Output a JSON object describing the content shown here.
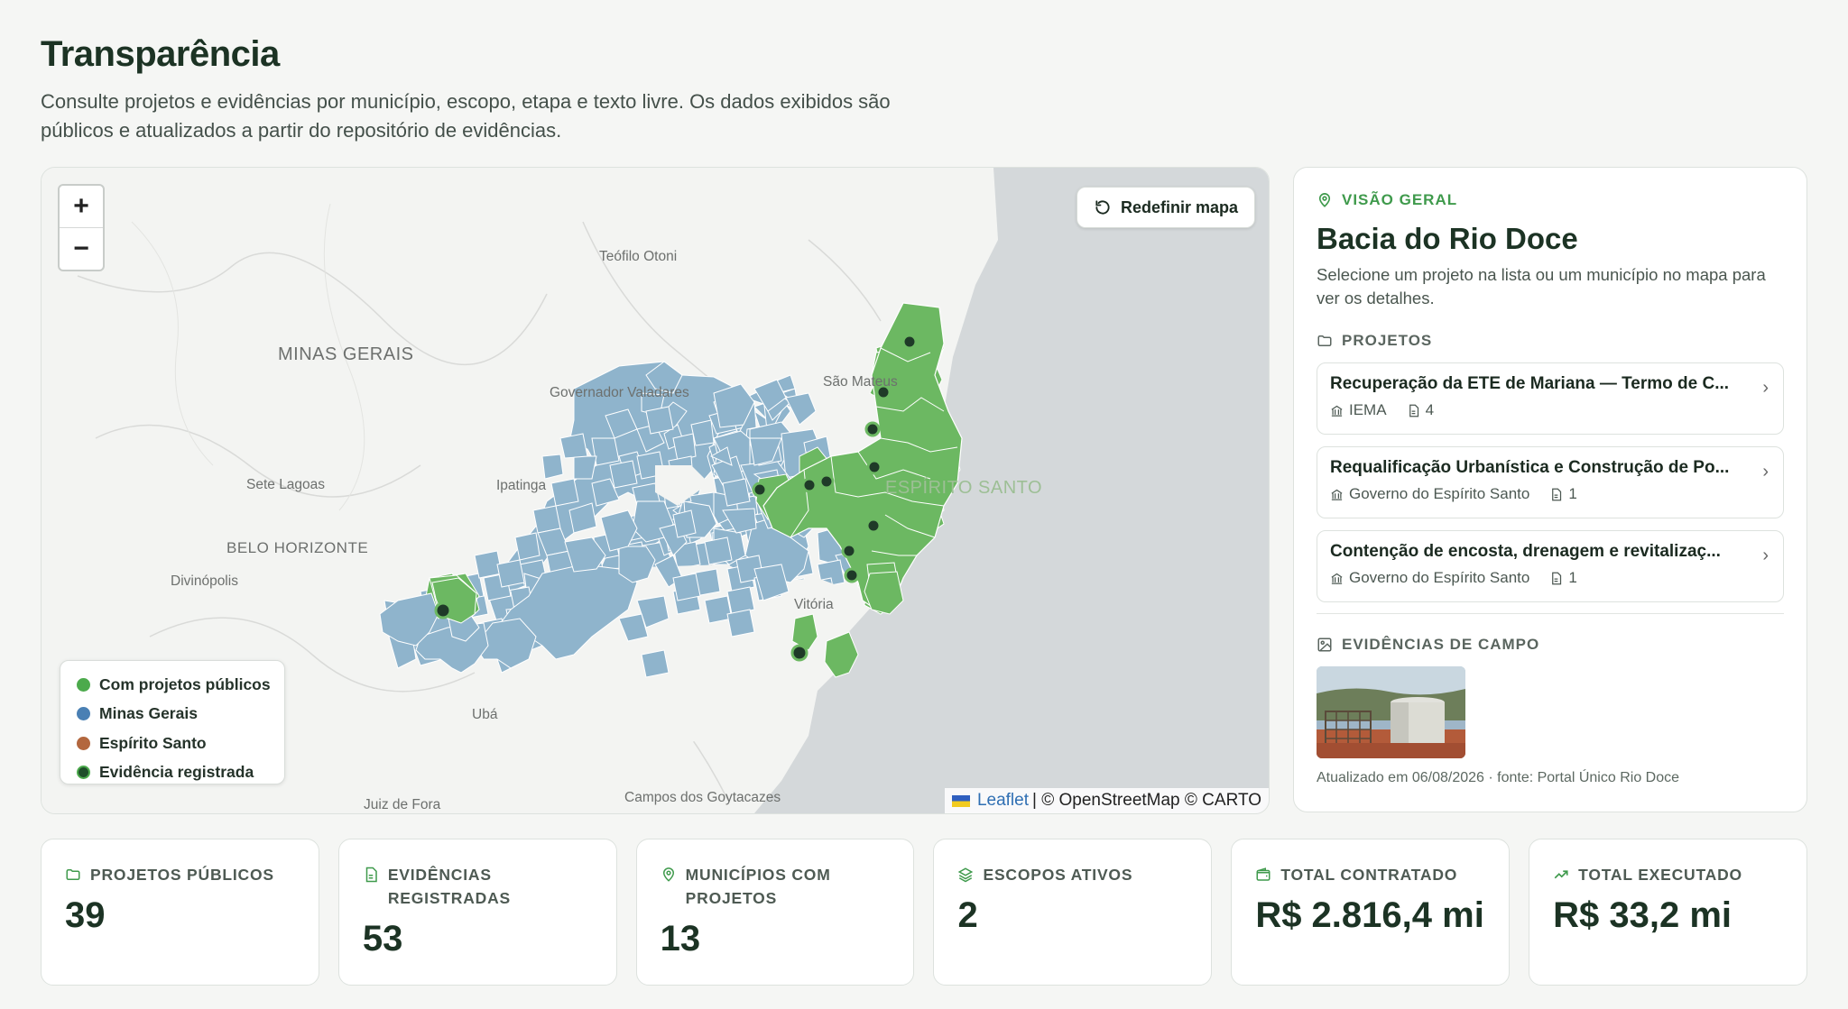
{
  "header": {
    "title": "Transparência",
    "subtitle_line1": "Consulte projetos e evidências por município, escopo, etapa e texto livre. Os dados exibidos são",
    "subtitle_line2": "públicos e atualizados a partir do repositório de evidências."
  },
  "map": {
    "zoom_in": "+",
    "zoom_out": "−",
    "reset_label": "Redefinir mapa",
    "state_labels": [
      "MINAS GERAIS",
      "ESPÍRITO SANTO"
    ],
    "city_labels": [
      "Teófilo Otoni",
      "Governador Valadares",
      "São Mateus",
      "Sete Lagoas",
      "Ipatinga",
      "BELO HORIZONTE",
      "Divinópolis",
      "Vitória",
      "Ubá",
      "Juiz de Fora",
      "Campos dos Goytacazes"
    ],
    "legend": [
      {
        "label": "Com projetos públicos",
        "color": "#4caa4c"
      },
      {
        "label": "Minas Gerais",
        "color": "#4a80b4"
      },
      {
        "label": "Espírito Santo",
        "color": "#b3673e"
      },
      {
        "label": "Evidência registrada",
        "color": "#1f4f2a"
      }
    ],
    "attribution": {
      "leaflet": "Leaflet",
      "rest": "| © OpenStreetMap © CARTO"
    },
    "colors": {
      "land": "#f3f4f2",
      "sea": "#d4d8da",
      "mg_region": "#8fb4cc",
      "public_projects": "#6cb862",
      "evidence_dot": "#1f3a28"
    }
  },
  "panel": {
    "eyebrow": "VISÃO GERAL",
    "title": "Bacia do Rio Doce",
    "description": "Selecione um projeto na lista ou um município no mapa para ver os detalhes.",
    "projects_label": "PROJETOS",
    "projects": [
      {
        "title": "Recuperação da ETE de Mariana — Termo de C...",
        "org": "IEMA",
        "docs": "4"
      },
      {
        "title": "Requalificação Urbanística e Construção de Po...",
        "org": "Governo do Espírito Santo",
        "docs": "1"
      },
      {
        "title": "Contenção de encosta, drenagem e revitalizaç...",
        "org": "Governo do Espírito Santo",
        "docs": "1"
      }
    ],
    "evidence_label": "EVIDÊNCIAS DE CAMPO",
    "updated": "Atualizado em 06/08/2026 · fonte: Portal Único Rio Doce"
  },
  "stats": [
    {
      "label": "PROJETOS PÚBLICOS",
      "value": "39",
      "icon": "folder-icon"
    },
    {
      "label": "EVIDÊNCIAS REGISTRADAS",
      "value": "53",
      "icon": "document-icon"
    },
    {
      "label": "MUNICÍPIOS COM PROJETOS",
      "value": "13",
      "icon": "map-pin-icon"
    },
    {
      "label": "ESCOPOS ATIVOS",
      "value": "2",
      "icon": "layers-icon"
    },
    {
      "label": "TOTAL CONTRATADO",
      "value": "R$ 2.816,4 mi",
      "icon": "wallet-icon"
    },
    {
      "label": "TOTAL EXECUTADO",
      "value": "R$ 33,2 mi",
      "icon": "trending-up-icon"
    }
  ]
}
